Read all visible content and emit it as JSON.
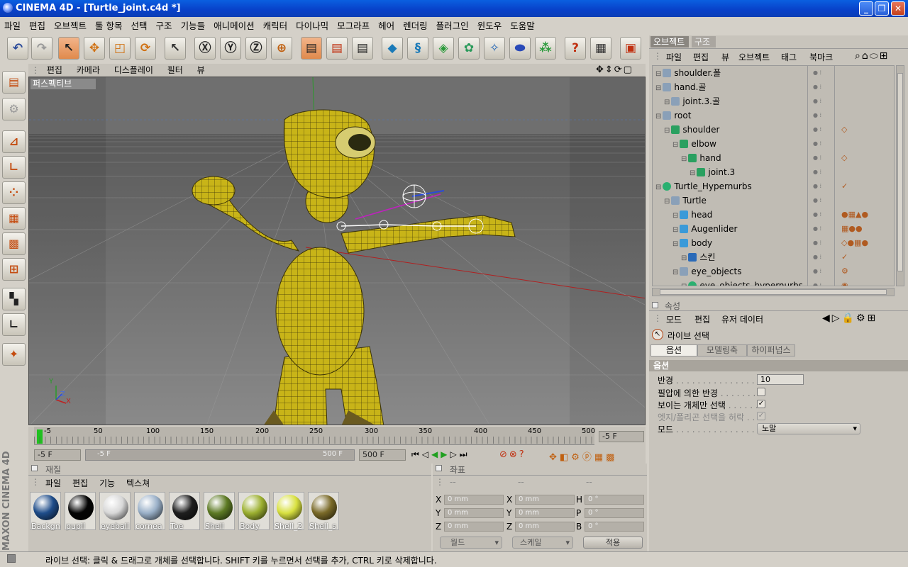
{
  "window": {
    "title": "CINEMA 4D - [Turtle_joint.c4d *]",
    "min": "_",
    "max": "❐",
    "close": "✕"
  },
  "menubar": [
    "파일",
    "편집",
    "오브젝트",
    "툴 항목",
    "선택",
    "구조",
    "기능들",
    "애니메이션",
    "캐릭터",
    "다이나믹",
    "모그라프",
    "헤어",
    "렌더링",
    "플러그인",
    "윈도우",
    "도움말"
  ],
  "viewport": {
    "menu": [
      "편집",
      "카메라",
      "디스플레이",
      "필터",
      "뷰"
    ],
    "label": "퍼스펙티브",
    "axes": {
      "y": "Y",
      "z": "Z",
      "x": "X"
    }
  },
  "timeline": {
    "ticks": [
      "-5",
      "50",
      "100",
      "150",
      "200",
      "250",
      "300",
      "350",
      "400",
      "450",
      "500"
    ],
    "current": "-5 F",
    "start": "-5 F",
    "range_left": "-5 F",
    "range_right": "500 F",
    "end": "500 F"
  },
  "material": {
    "title": "재질",
    "menu": [
      "파일",
      "편집",
      "기능",
      "텍스쳐"
    ],
    "items": [
      {
        "label": "Backgn",
        "color": "#1f4d8a"
      },
      {
        "label": "pupil",
        "color": "#050505"
      },
      {
        "label": "eyeball",
        "color": "#d8d8d8"
      },
      {
        "label": "cornea",
        "color": "#9ab0c8"
      },
      {
        "label": "Toe",
        "color": "#1e1e1e"
      },
      {
        "label": "Shell",
        "color": "#5d7a24"
      },
      {
        "label": "Body",
        "color": "#9cb030"
      },
      {
        "label": "Shell_2",
        "color": "#d8e040"
      },
      {
        "label": "Shell_s",
        "color": "#7a6a28"
      }
    ]
  },
  "coords": {
    "title": "좌표",
    "headers": [
      "--",
      "--",
      "--"
    ],
    "rows": [
      {
        "a": "X",
        "av": "0 mm",
        "b": "X",
        "bv": "0 mm",
        "c": "H",
        "cv": "0 °"
      },
      {
        "a": "Y",
        "av": "0 mm",
        "b": "Y",
        "bv": "0 mm",
        "c": "P",
        "cv": "0 °"
      },
      {
        "a": "Z",
        "av": "0 mm",
        "b": "Z",
        "bv": "0 mm",
        "c": "B",
        "cv": "0 °"
      }
    ],
    "world": "월드",
    "scale": "스케일",
    "apply": "적용"
  },
  "objects": {
    "tabs": [
      "오브젝트",
      "구조"
    ],
    "menu": [
      "파일",
      "편집",
      "뷰",
      "오브젝트",
      "태그",
      "북마크"
    ],
    "rows": [
      {
        "name": "shoulder.폴",
        "indent": 0,
        "icon": "joint"
      },
      {
        "name": "hand.골",
        "indent": 0,
        "icon": "joint"
      },
      {
        "name": "joint.3.골",
        "indent": 1,
        "icon": "joint"
      },
      {
        "name": "root",
        "indent": 0,
        "icon": "joint"
      },
      {
        "name": "shoulder",
        "indent": 1,
        "icon": "bone"
      },
      {
        "name": "elbow",
        "indent": 2,
        "icon": "bone"
      },
      {
        "name": "hand",
        "indent": 3,
        "icon": "bone"
      },
      {
        "name": "joint.3",
        "indent": 4,
        "icon": "bone"
      },
      {
        "name": "Turtle_Hypernurbs",
        "indent": 0,
        "icon": "nurbs"
      },
      {
        "name": "Turtle",
        "indent": 1,
        "icon": "joint"
      },
      {
        "name": "head",
        "indent": 2,
        "icon": "poly"
      },
      {
        "name": "Augenlider",
        "indent": 2,
        "icon": "poly"
      },
      {
        "name": "body",
        "indent": 2,
        "icon": "poly"
      },
      {
        "name": "스킨",
        "indent": 3,
        "icon": "skin"
      },
      {
        "name": "eye_objects",
        "indent": 2,
        "icon": "joint"
      },
      {
        "name": "eye_objects_hypernurbs",
        "indent": 3,
        "icon": "nurbs"
      }
    ]
  },
  "attributes": {
    "title": "속성",
    "menu": [
      "모드",
      "편집",
      "유저 데이터"
    ],
    "tool": "라이브 선택",
    "tabs": [
      "옵션",
      "모델링축",
      "하이퍼넙스"
    ],
    "section": "옵션",
    "fields": [
      {
        "label": "반경",
        "value": "10"
      },
      {
        "label": "필압에 의한 반경",
        "value": ""
      },
      {
        "label": "보이는 개체만 선택",
        "value": ""
      },
      {
        "label": "엣지/폴리곤 선택을 허락",
        "value": ""
      },
      {
        "label": "모드",
        "value": "노말"
      }
    ]
  },
  "status": "라이브 선택: 클릭 & 드래그로 개체를 선택합니다. SHIFT 키를 누르면서 선택를 추가, CTRL 키로 삭제합니다.",
  "brand": "MAXON CINEMA 4D"
}
